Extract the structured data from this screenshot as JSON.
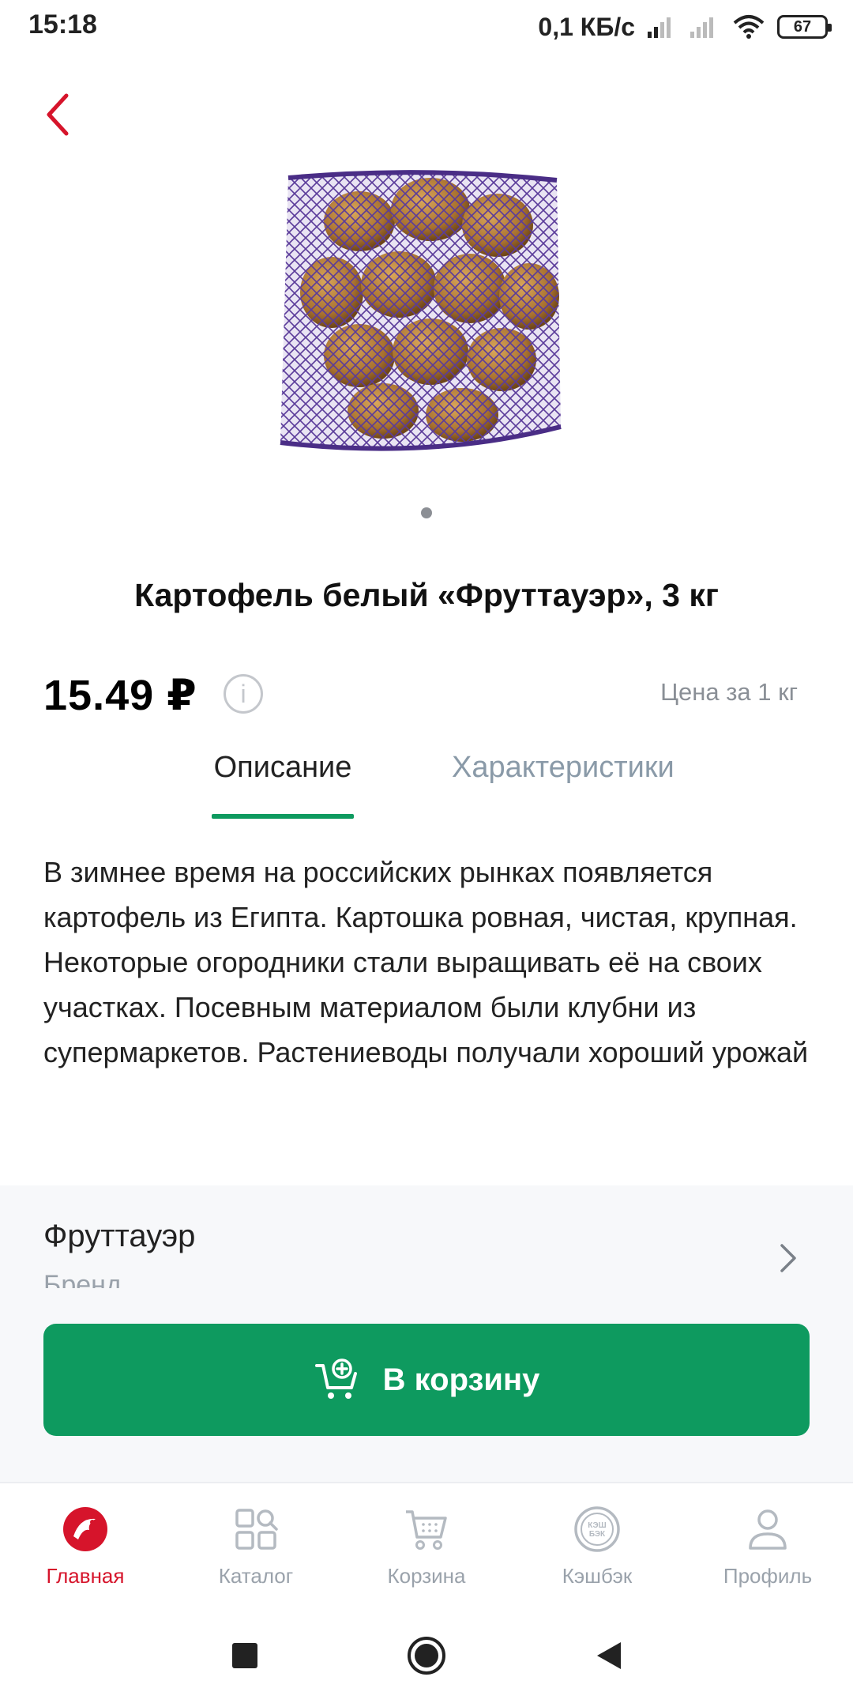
{
  "status_bar": {
    "time": "15:18",
    "network_speed": "0,1 КБ/с",
    "battery": "67"
  },
  "nav": {
    "back_icon": "chevron-left-icon"
  },
  "product": {
    "image_icon": "potato-bag-image",
    "title": "Картофель белый «Фруттауэр», 3 кг",
    "price": "15.49 ₽",
    "info_icon": "i",
    "price_unit": "Цена за 1 кг"
  },
  "tabs": [
    {
      "label": "Описание",
      "active": true
    },
    {
      "label": "Характеристики",
      "active": false
    }
  ],
  "description": "В зимнее время на российских рынках появляется картофель из Египта. Картошка ровная, чистая, крупная. Некоторые огородники стали выращивать её на своих участках. Посевным материалом были клубни из супермаркетов. Растениеводы получали хороший урожай",
  "brand": {
    "name": "Фруттауэр",
    "label": "Бренд"
  },
  "cart_button": {
    "label": "В корзину"
  },
  "bottom_nav": {
    "items": [
      {
        "label": "Главная",
        "icon": "home-logo-icon",
        "active": true
      },
      {
        "label": "Каталог",
        "icon": "catalog-icon",
        "active": false
      },
      {
        "label": "Корзина",
        "icon": "cart-icon",
        "active": false
      },
      {
        "label": "Кэшбэк",
        "icon": "cashback-icon",
        "active": false
      },
      {
        "label": "Профиль",
        "icon": "profile-icon",
        "active": false
      }
    ],
    "cashback_icon_text": "КЭШ БЭК"
  },
  "colors": {
    "accent_green": "#0e9a5f",
    "brand_red": "#d6142b",
    "muted": "#9aa2ab"
  }
}
